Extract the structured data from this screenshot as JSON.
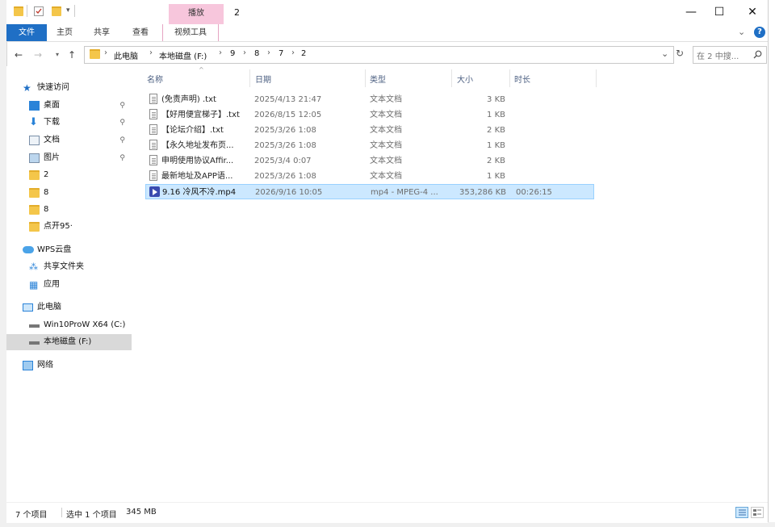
{
  "window": {
    "title": "2",
    "context_tab": "播放",
    "minimize": "—",
    "maximize": "☐",
    "close": "✕"
  },
  "ribbon": {
    "tabs": [
      "文件",
      "主页",
      "共享",
      "查看",
      "视频工具"
    ],
    "collapse": "⌄",
    "help": "?"
  },
  "address": {
    "crumbs": [
      "此电脑",
      "本地磁盘 (F:)",
      "9",
      "8",
      "7",
      "2"
    ],
    "dropdown": "⌄",
    "refresh": "↻",
    "search_placeholder": "在 2 中搜..."
  },
  "nav": {
    "quick_access": "快速访问",
    "items_quick": [
      "桌面",
      "下载",
      "文档",
      "图片",
      "2",
      "8",
      "8",
      "点开95·"
    ],
    "wps": "WPS云盘",
    "wps_items": [
      "共享文件夹",
      "应用"
    ],
    "this_pc": "此电脑",
    "drives": [
      "Win10ProW X64 (C:)",
      "本地磁盘 (F:)"
    ],
    "network": "网络",
    "pin": "📌"
  },
  "columns": [
    "名称",
    "日期",
    "类型",
    "大小",
    "时长"
  ],
  "files": [
    {
      "name": "(免责声明) .txt",
      "date": "2025/4/13 21:47",
      "type": "文本文档",
      "size": "3 KB",
      "duration": "",
      "icon": "text-file-icon"
    },
    {
      "name": "【好用便宜梯子】.txt",
      "date": "2026/8/15 12:05",
      "type": "文本文档",
      "size": "1 KB",
      "duration": "",
      "icon": "text-file-icon"
    },
    {
      "name": "【论坛介绍】.txt",
      "date": "2025/3/26 1:08",
      "type": "文本文档",
      "size": "2 KB",
      "duration": "",
      "icon": "text-file-icon"
    },
    {
      "name": "【永久地址发布页...",
      "date": "2025/3/26 1:08",
      "type": "文本文档",
      "size": "1 KB",
      "duration": "",
      "icon": "text-file-icon"
    },
    {
      "name": "申明使用协议Affir...",
      "date": "2025/3/4 0:07",
      "type": "文本文档",
      "size": "2 KB",
      "duration": "",
      "icon": "text-file-icon"
    },
    {
      "name": "最新地址及APP语...",
      "date": "2025/3/26 1:08",
      "type": "文本文档",
      "size": "1 KB",
      "duration": "",
      "icon": "text-file-icon"
    },
    {
      "name": "9.16 冷风不冷.mp4",
      "date": "2026/9/16 10:05",
      "type": "mp4 - MPEG-4 ...",
      "size": "353,286 KB",
      "duration": "00:26:15",
      "icon": "video-file-icon"
    }
  ],
  "status": {
    "count": "7 个项目",
    "selected": "选中 1 个项目",
    "size": "345 MB"
  },
  "colors": {
    "file_tab": "#1f6fc5",
    "context_pink": "#f7c6dc",
    "selection": "#cce8ff"
  }
}
